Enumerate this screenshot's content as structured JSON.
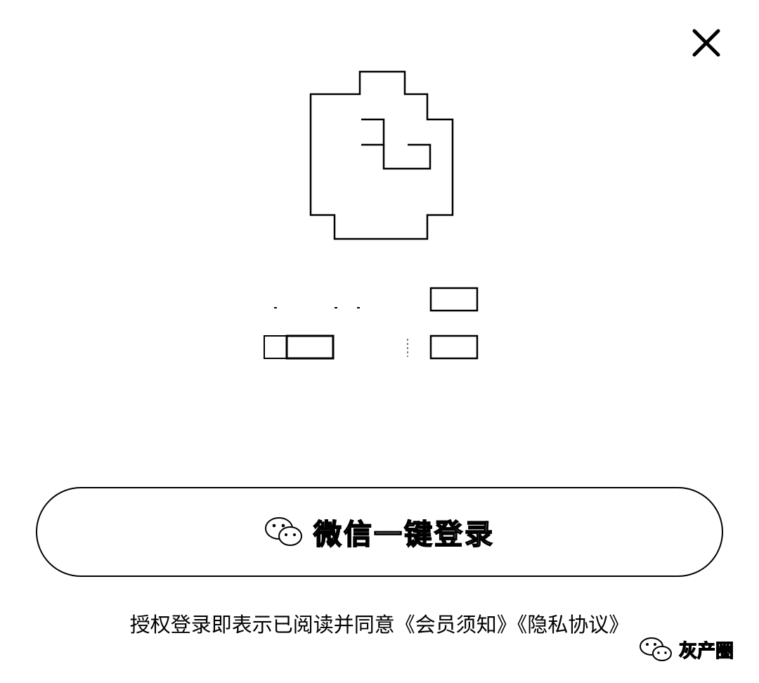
{
  "dialog": {
    "close_icon": "close-icon"
  },
  "logo": {
    "icon": "app-logo-icon"
  },
  "login": {
    "wechat_button_label": "微信一键登录",
    "wechat_icon": "wechat-icon"
  },
  "agreement": {
    "prefix": "授权登录即表示已阅读并同意",
    "member_notice_link": "《会员须知》",
    "privacy_link": "《隐私协议》"
  },
  "watermark": {
    "text": "灰产圈",
    "icon": "wechat-icon"
  }
}
